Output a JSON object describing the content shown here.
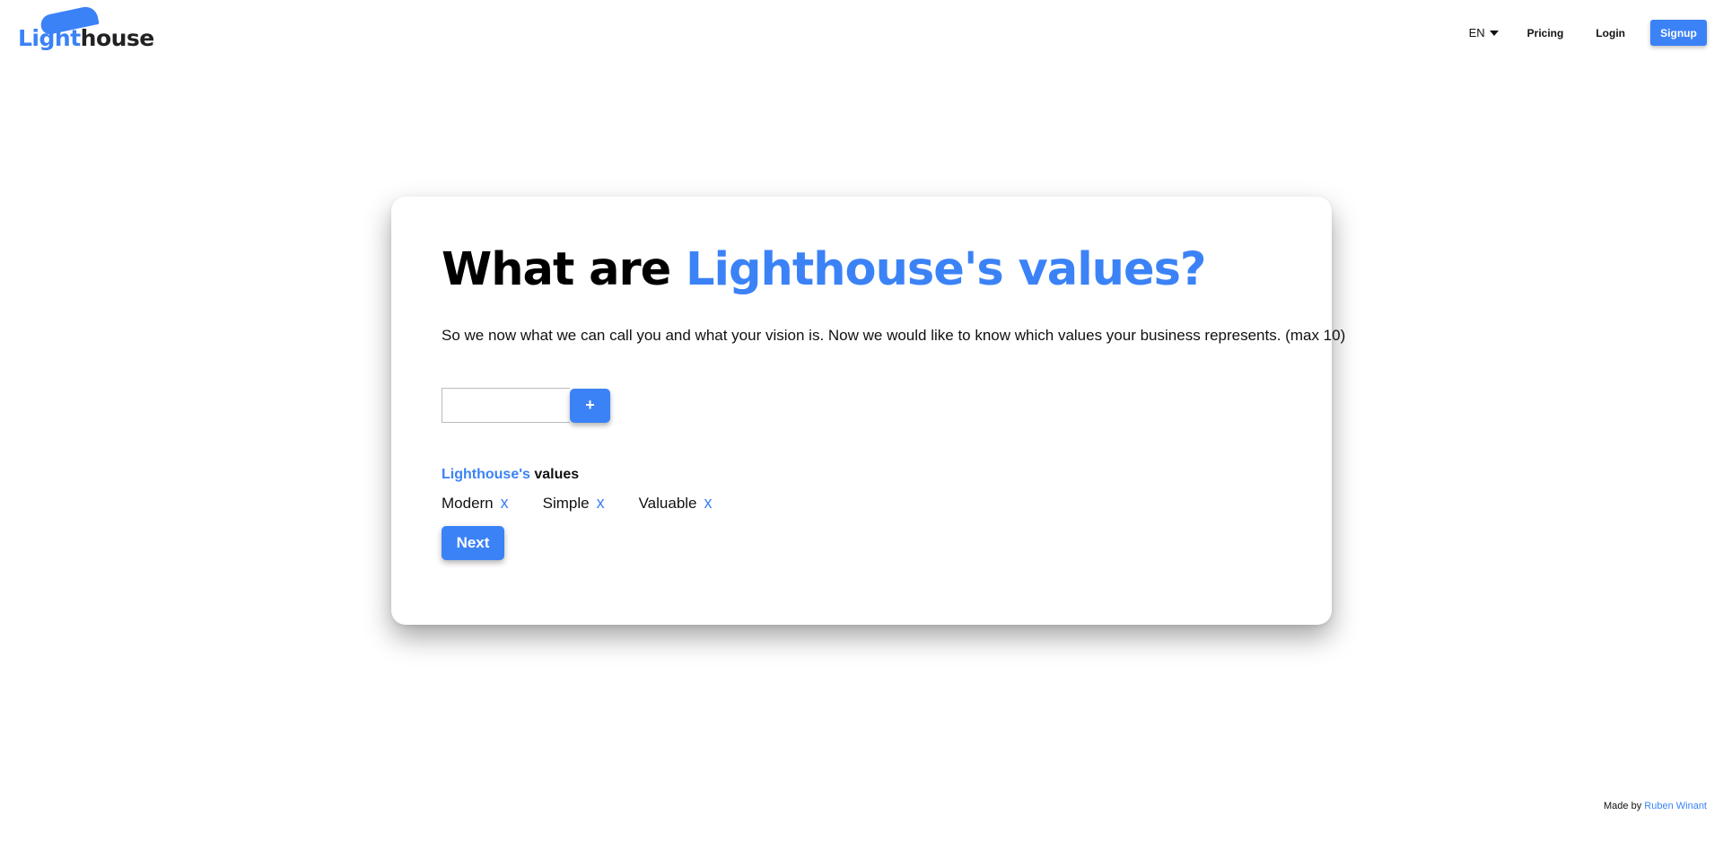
{
  "brand": {
    "logo_part_blue": "Light",
    "logo_part_dark": "house",
    "accent_color": "#3b82f6"
  },
  "nav": {
    "language": "EN",
    "pricing": "Pricing",
    "login": "Login",
    "signup": "Signup"
  },
  "card": {
    "title_prefix": "What are",
    "title_accent": "Lighthouse's values?",
    "description": "So we now what we can call you and what your vision is. Now we would like to know which values your business represents. (max 10)",
    "input_value": "",
    "add_button": "+",
    "values_heading_accent": "Lighthouse's",
    "values_heading_rest": "values",
    "values": [
      {
        "label": "Modern",
        "remove": "x"
      },
      {
        "label": "Simple",
        "remove": "x"
      },
      {
        "label": "Valuable",
        "remove": "x"
      }
    ],
    "next_button": "Next"
  },
  "footer": {
    "made_by": "Made by",
    "author": "Ruben Winant"
  }
}
